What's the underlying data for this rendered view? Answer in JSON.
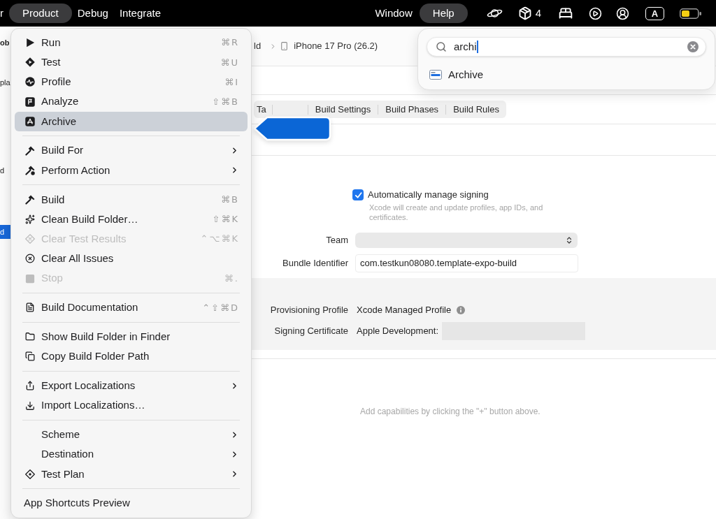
{
  "menu_bar": {
    "left_items": [
      {
        "label": "r",
        "selected": false
      },
      {
        "label": "Product",
        "selected": true
      },
      {
        "label": "Debug",
        "selected": false
      },
      {
        "label": "Integrate",
        "selected": false
      }
    ],
    "right_items": [
      {
        "label": "Window",
        "selected": false
      },
      {
        "label": "Help",
        "selected": true
      }
    ],
    "status_count": "4",
    "input_source": "A"
  },
  "sidebar": {
    "items": [
      {
        "label": "ob",
        "kind": "title",
        "selected": false
      },
      {
        "label": "pla",
        "kind": "item",
        "selected": false
      },
      {
        "label": "d",
        "kind": "item",
        "selected": false
      },
      {
        "label": "d",
        "kind": "item",
        "selected": true
      }
    ]
  },
  "toolbar": {
    "scheme": "ld",
    "destination": "iPhone 17 Pro (26.2)"
  },
  "editor_tabs": [
    {
      "label": "Ta",
      "selected": false
    },
    {
      "label": "Build Settings",
      "selected": false
    },
    {
      "label": "Build Phases",
      "selected": false
    },
    {
      "label": "Build Rules",
      "selected": false
    }
  ],
  "signing": {
    "auto_manage": {
      "label": "Automatically manage signing",
      "checked": true,
      "description": "Xcode will create and update profiles, app IDs, and certificates."
    },
    "team": {
      "label": "Team"
    },
    "bundle_identifier": {
      "label": "Bundle Identifier",
      "value": "com.testkun08080.template-expo-build"
    },
    "provisioning_profile": {
      "label": "Provisioning Profile",
      "value": "Xcode Managed Profile"
    },
    "signing_certificate": {
      "label": "Signing Certificate",
      "value": "Apple Development:"
    }
  },
  "capabilities_hint": "Add capabilities by clicking the \"+\" button above.",
  "help_search": {
    "query": "archi",
    "results": [
      {
        "label": "Archive",
        "selected": false
      }
    ]
  },
  "product_menu": {
    "groups": [
      {
        "items": [
          {
            "label": "Run",
            "shortcut": "⌘R",
            "submenu": false,
            "disabled": false,
            "selected": false
          },
          {
            "label": "Test",
            "shortcut": "⌘U",
            "submenu": false,
            "disabled": false,
            "selected": false
          },
          {
            "label": "Profile",
            "shortcut": "⌘I",
            "submenu": false,
            "disabled": false,
            "selected": false
          },
          {
            "label": "Analyze",
            "shortcut": "⇧⌘B",
            "submenu": false,
            "disabled": false,
            "selected": false
          },
          {
            "label": "Archive",
            "submenu": false,
            "disabled": false,
            "selected": true
          }
        ]
      },
      {
        "items": [
          {
            "label": "Build For",
            "submenu": true,
            "disabled": false,
            "selected": false
          },
          {
            "label": "Perform Action",
            "submenu": true,
            "disabled": false,
            "selected": false
          }
        ]
      },
      {
        "items": [
          {
            "label": "Build",
            "shortcut": "⌘B",
            "submenu": false,
            "disabled": false,
            "selected": false
          },
          {
            "label": "Clean Build Folder…",
            "shortcut": "⇧⌘K",
            "submenu": false,
            "disabled": false,
            "selected": false
          },
          {
            "label": "Clear Test Results",
            "shortcut": "⌃⌥⌘K",
            "submenu": false,
            "disabled": true,
            "selected": false
          },
          {
            "label": "Clear All Issues",
            "submenu": false,
            "disabled": false,
            "selected": false
          },
          {
            "label": "Stop",
            "shortcut": "⌘.",
            "submenu": false,
            "disabled": true,
            "selected": false
          }
        ]
      },
      {
        "items": [
          {
            "label": "Build Documentation",
            "shortcut": "⌃⇧⌘D",
            "submenu": false,
            "disabled": false,
            "selected": false
          }
        ]
      },
      {
        "items": [
          {
            "label": "Show Build Folder in Finder",
            "submenu": false,
            "disabled": false,
            "selected": false
          },
          {
            "label": "Copy Build Folder Path",
            "submenu": false,
            "disabled": false,
            "selected": false
          }
        ]
      },
      {
        "items": [
          {
            "label": "Export Localizations",
            "submenu": true,
            "disabled": false,
            "selected": false
          },
          {
            "label": "Import Localizations…",
            "submenu": false,
            "disabled": false,
            "selected": false
          }
        ]
      },
      {
        "items": [
          {
            "label": "Scheme",
            "submenu": true,
            "disabled": false,
            "selected": false
          },
          {
            "label": "Destination",
            "submenu": true,
            "disabled": false,
            "selected": false
          },
          {
            "label": "Test Plan",
            "submenu": true,
            "disabled": false,
            "selected": false
          }
        ]
      }
    ],
    "footer": "App Shortcuts Preview"
  }
}
